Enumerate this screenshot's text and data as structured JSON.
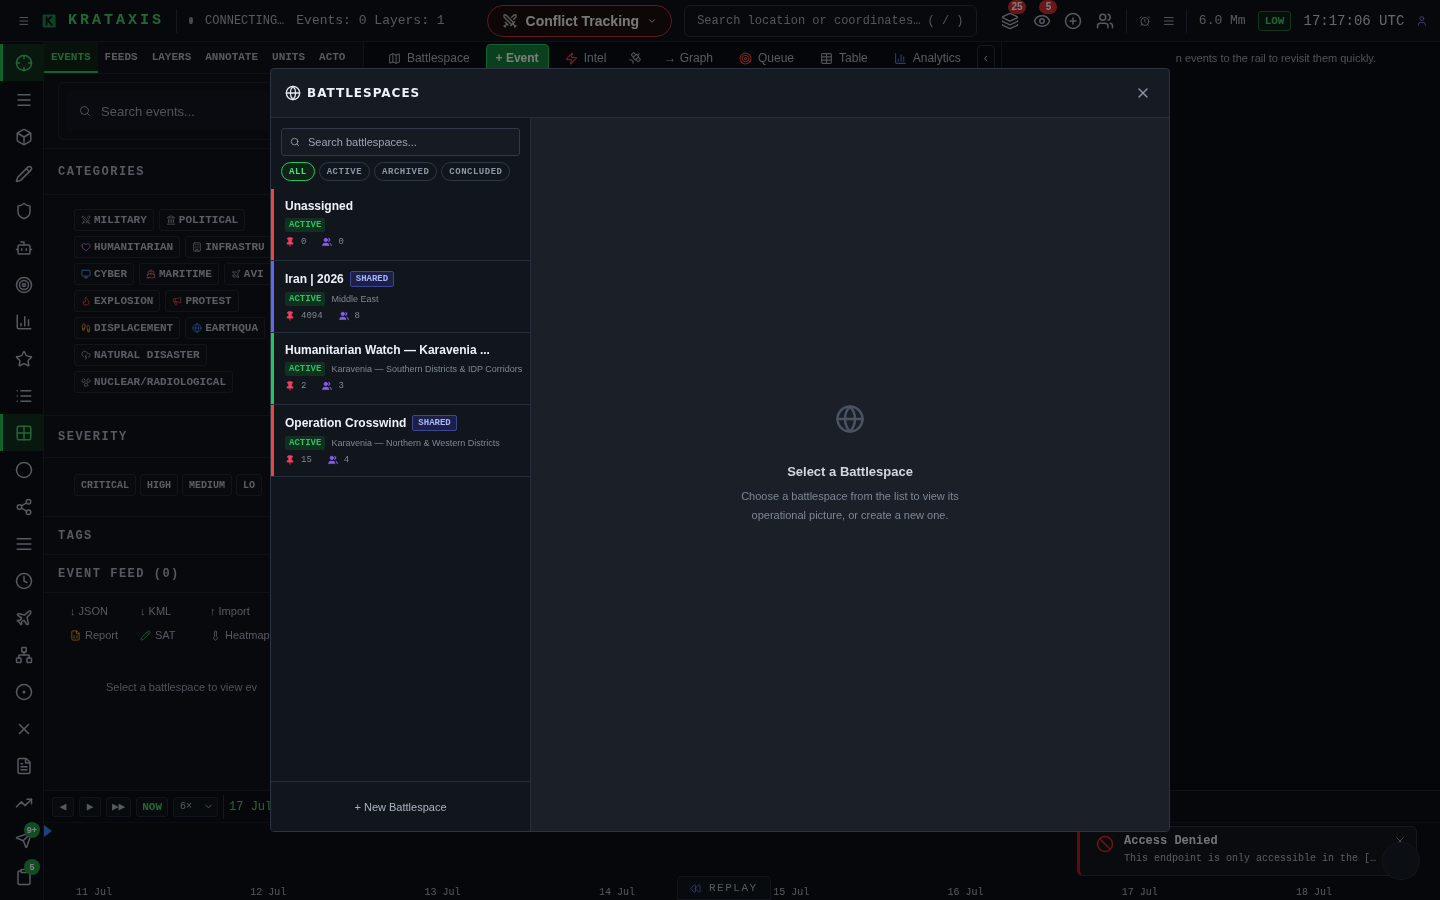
{
  "topbar": {
    "brand": "KRATAXIS",
    "status": "CONNECTING…",
    "counts": "Events: 0 Layers: 1",
    "mode": "Conflict Tracking",
    "search_placeholder": "Search location or coordinates… ( / )",
    "badges": [
      "25",
      "5"
    ],
    "scale": "6.0 Mm",
    "level": "LOW",
    "clock": "17:17:06 UTC"
  },
  "rail": [
    {
      "selected": true
    },
    {
      "selected": false
    },
    {
      "selected": false
    },
    {
      "selected": false
    },
    {
      "selected": false
    },
    {
      "selected": false
    },
    {
      "selected": false
    },
    {
      "selected": false
    },
    {
      "selected": false
    },
    {
      "selected": false
    },
    {
      "selected": true
    },
    {
      "selected": false
    },
    {
      "selected": false
    },
    {
      "selected": false
    },
    {
      "selected": false
    },
    {
      "selected": false
    },
    {
      "selected": false
    },
    {
      "selected": false
    },
    {
      "selected": false
    },
    {
      "selected": false
    },
    {
      "selected": false
    },
    {
      "selected": false,
      "badge": "9+"
    },
    {
      "selected": false,
      "badge": "5"
    }
  ],
  "panel_tabs": [
    {
      "label": "EVENTS",
      "selected": true
    },
    {
      "label": "FEEDS",
      "selected": false
    },
    {
      "label": "LAYERS",
      "selected": false
    },
    {
      "label": "ANNOTATE",
      "selected": false
    },
    {
      "label": "UNITS",
      "selected": false
    },
    {
      "label": "ACTO",
      "selected": false
    }
  ],
  "event_search": {
    "placeholder": "Search events..."
  },
  "categories": {
    "title": "CATEGORIES",
    "rows": [
      [
        "MILITARY",
        "POLITICAL"
      ],
      [
        "HUMANITARIAN",
        "INFRASTRU"
      ],
      [
        "CYBER",
        "MARITIME",
        "AVI"
      ],
      [
        "EXPLOSION",
        "PROTEST"
      ],
      [
        "DISPLACEMENT",
        "EARTHQUA"
      ],
      [
        "NATURAL DISASTER"
      ],
      [
        "NUCLEAR/RADIOLOGICAL"
      ]
    ]
  },
  "severity": {
    "title": "SEVERITY",
    "chips": [
      "CRITICAL",
      "HIGH",
      "MEDIUM",
      "LO"
    ]
  },
  "tags": {
    "title": "TAGS"
  },
  "feed": {
    "title": "EVENT FEED (0)",
    "actions": [
      "↓ JSON",
      "↓ KML",
      "↑ Import"
    ],
    "tools": [
      "Report",
      "SAT",
      "Heatmap"
    ],
    "empty": "Select a battlespace to view ev"
  },
  "toolbar": [
    {
      "kind": "plain",
      "label": "Battlespace"
    },
    {
      "kind": "primary",
      "label": "+ Event"
    },
    {
      "kind": "plain",
      "label": "Intel"
    },
    {
      "kind": "icon"
    },
    {
      "kind": "plain",
      "label": "→ Graph"
    },
    {
      "kind": "plain",
      "label": "Queue"
    },
    {
      "kind": "plain",
      "label": "Table"
    },
    {
      "kind": "plain",
      "label": "Analytics"
    },
    {
      "kind": "collapse",
      "label": "‹"
    }
  ],
  "side_hint": "n events to the rail to revisit them quickly.",
  "timeline": {
    "controls": [
      "◀",
      "▶",
      "▶▶"
    ],
    "now": "NOW",
    "speed": "6×",
    "date": "17 Jul",
    "ticks": [
      "11 Jul",
      "12 Jul",
      "13 Jul",
      "14 Jul",
      "15 Jul",
      "16 Jul",
      "17 Jul",
      "18 Jul"
    ],
    "replay": "REPLAY"
  },
  "toast": {
    "title": "Access Denied",
    "message": "This endpoint is only accessible in the […"
  },
  "modal": {
    "title": "BATTLESPACES",
    "search_placeholder": "Search battlespaces...",
    "filters": [
      {
        "label": "ALL",
        "selected": true
      },
      {
        "label": "ACTIVE",
        "selected": false
      },
      {
        "label": "ARCHIVED",
        "selected": false
      },
      {
        "label": "CONCLUDED",
        "selected": false
      }
    ],
    "items": [
      {
        "name": "Unassigned",
        "color": "#ef4444",
        "status": "ACTIVE",
        "pins": "0",
        "members": "0"
      },
      {
        "name": "Iran | 2026",
        "color": "#6366f1",
        "badge": "SHARED",
        "status": "ACTIVE",
        "region": "Middle East",
        "pins": "4094",
        "members": "8"
      },
      {
        "name": "Humanitarian Watch — Karavenia ...",
        "color": "#22c55e",
        "status": "ACTIVE",
        "region": "Karavenia — Southern Districts & IDP Corridors",
        "pins": "2",
        "members": "3"
      },
      {
        "name": "Operation Crosswind",
        "color": "#ef4444",
        "badge": "SHARED",
        "status": "ACTIVE",
        "region": "Karavenia — Northern & Western Districts",
        "pins": "15",
        "members": "4"
      }
    ],
    "new_button": "+ New Battlespace",
    "empty_title": "Select a Battlespace",
    "empty_text": "Choose a battlespace from the list to view its operational picture, or create a new one."
  }
}
